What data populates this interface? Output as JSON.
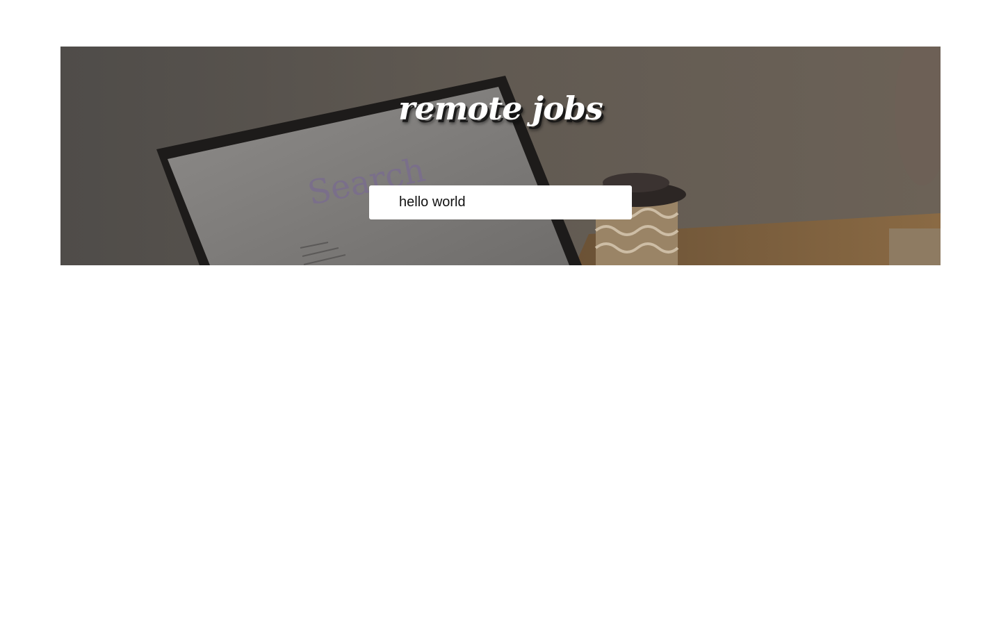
{
  "hero": {
    "title": "remote jobs",
    "background_image": "laptop-and-coffee-cup-photo"
  },
  "search": {
    "value": "hello world",
    "placeholder": ""
  },
  "colors": {
    "overlay": "#5f5850",
    "search_bg": "#ffffff",
    "title": "#ffffff"
  }
}
